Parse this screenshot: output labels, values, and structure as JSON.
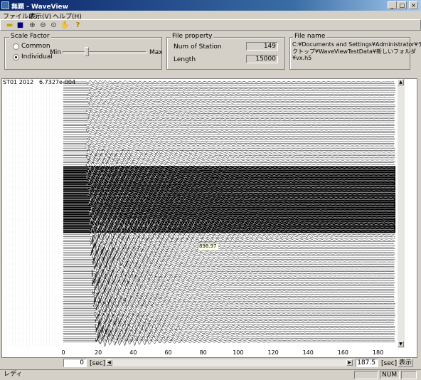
{
  "window": {
    "title": "無題 - WaveView"
  },
  "menu": {
    "file": "ファイル(F)",
    "view": "表示(V)",
    "help": "ヘルプ(H)"
  },
  "toolbar": {
    "icons": [
      "open-folder-icon",
      "save-icon",
      "zoom-in-icon",
      "zoom-out-icon",
      "zoom-icon",
      "hand-icon",
      "help-icon"
    ]
  },
  "scale_factor": {
    "legend": "Scale Factor",
    "option_common": "Common",
    "option_individual": "Individual",
    "selected": "Individual",
    "min_label": "Min",
    "max_label": "Max",
    "slider_level": 0.28
  },
  "file_property": {
    "legend": "File property",
    "num_station_label": "Num of Station",
    "num_station_value": "149",
    "length_label": "Length",
    "length_value": "15000"
  },
  "file_name": {
    "legend": "File name",
    "line1": "C:¥Documents and Settings¥Administrator¥デス",
    "line2": "クトップ¥WaveViewTestData¥新しいフォルダ",
    "line3": "¥vx.h5"
  },
  "station_header": {
    "id": "ST01 2012",
    "value": "6.7327e-004"
  },
  "cursor_tooltip": "898.97",
  "x_axis": {
    "ticks": [
      "0",
      "20",
      "40",
      "60",
      "80",
      "100",
      "120",
      "140",
      "160",
      "180"
    ],
    "min": 0,
    "max": 187.5
  },
  "bottom": {
    "start_value": "0",
    "start_unit": "[sec]",
    "end_value": "187.5",
    "end_unit": "[sec]",
    "show_button": "表示"
  },
  "status": {
    "ready": "レディ",
    "num": "NUM"
  }
}
